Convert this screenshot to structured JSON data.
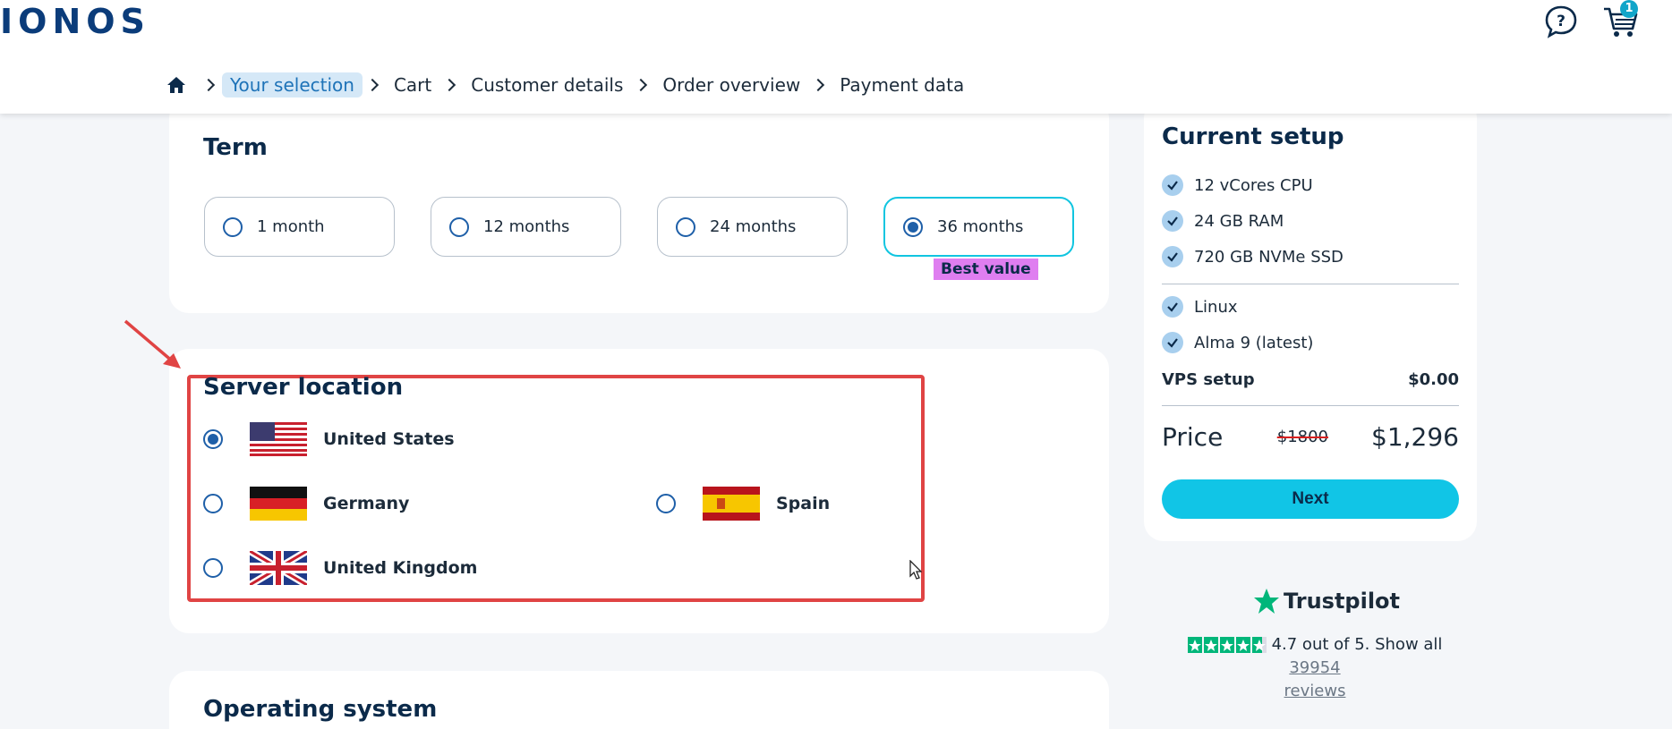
{
  "header": {
    "logo": "IONOS",
    "cart_count": "1",
    "breadcrumb": [
      "Your selection",
      "Cart",
      "Customer details",
      "Order overview",
      "Payment data"
    ]
  },
  "term": {
    "title": "Term",
    "options": [
      "1 month",
      "12 months",
      "24 months",
      "36 months"
    ],
    "selected": "36 months",
    "badge": "Best value"
  },
  "location": {
    "title": "Server location",
    "options": [
      "United States",
      "Germany",
      "Spain",
      "United Kingdom"
    ],
    "selected": "United States"
  },
  "os": {
    "title": "Operating system"
  },
  "setup": {
    "title": "Current setup",
    "features": [
      "12 vCores CPU",
      "24 GB RAM",
      "720 GB NVMe SSD",
      "Linux",
      "Alma 9 (latest)"
    ],
    "vps_label": "VPS setup",
    "vps_value": "$0.00",
    "price_label": "Price",
    "price_old": "$1800",
    "price_new": "$1,296",
    "next_label": "Next"
  },
  "trustpilot": {
    "name": "Trustpilot",
    "rating_text": "4.7 out of 5. Show all",
    "reviews_count": "39954",
    "reviews_label": "reviews"
  },
  "colors": {
    "accent": "#11c5e6",
    "highlight": "#e04444",
    "badge": "#df7ef0",
    "brand": "#0b3c7a"
  }
}
